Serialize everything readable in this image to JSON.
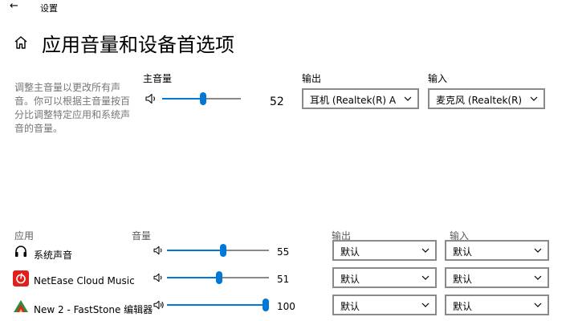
{
  "window": {
    "title": "设置",
    "back_icon": "back-arrow-icon"
  },
  "page": {
    "title": "应用音量和设备首选项",
    "home_icon": "home-icon"
  },
  "description": "调整主音量以更改所有声音。你可以根据主音量按百分比调整特定应用和系统声音的音量。",
  "master": {
    "label": "主音量",
    "icon": "speaker-icon",
    "volume": 52,
    "volume_text": "52",
    "output_label": "输出",
    "output_value": "耳机 (Realtek(R) Au...",
    "input_label": "输入",
    "input_value": "麦克风 (Realtek(R) A..."
  },
  "apps_header": {
    "app": "应用",
    "volume": "音量",
    "output": "输出",
    "input": "输入"
  },
  "apps": [
    {
      "name": "系统声音",
      "icon": "system-sounds-icon",
      "volume": 55,
      "volume_text": "55",
      "output": "默认",
      "input": "默认"
    },
    {
      "name": "NetEase Cloud Music",
      "icon": "netease-cloud-music-icon",
      "volume": 51,
      "volume_text": "51",
      "output": "默认",
      "input": "默认"
    },
    {
      "name": "New 2 - FastStone 编辑器",
      "icon": "faststone-icon",
      "volume": 100,
      "volume_text": "100",
      "output": "默认",
      "input": "默认"
    }
  ],
  "colors": {
    "accent": "#0078d7",
    "track": "#8a8a8a",
    "description_text": "#767676",
    "netease_red": "#e0201b"
  }
}
